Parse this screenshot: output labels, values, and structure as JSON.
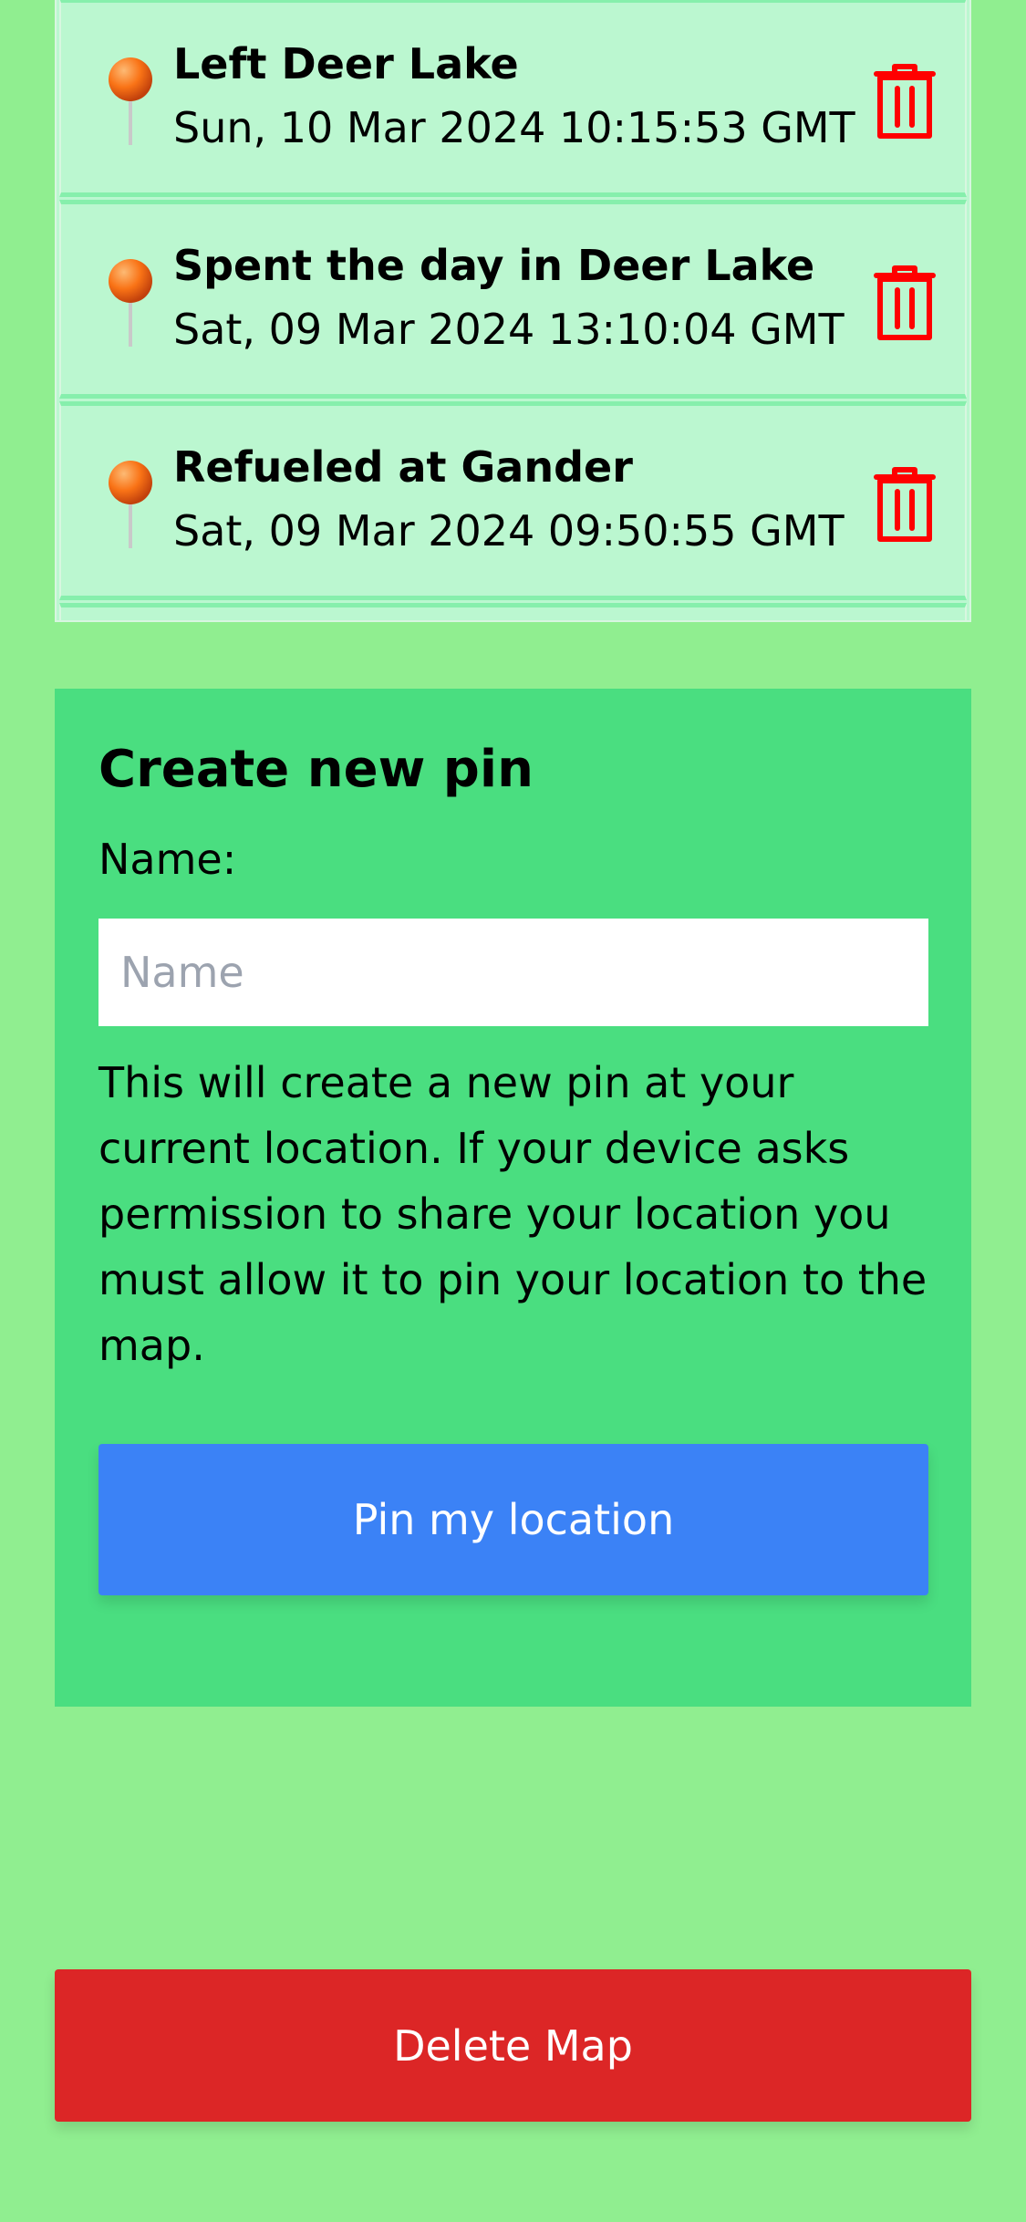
{
  "pins": [
    {
      "name": "Left Deer Lake",
      "date": "Sun, 10 Mar 2024 10:15:53 GMT"
    },
    {
      "name": "Spent the day in Deer Lake",
      "date": "Sat, 09 Mar 2024 13:10:04 GMT"
    },
    {
      "name": "Refueled at Gander",
      "date": "Sat, 09 Mar 2024 09:50:55 GMT"
    }
  ],
  "create": {
    "title": "Create new pin",
    "name_label": "Name:",
    "name_placeholder": "Name",
    "name_value": "",
    "help_text": "This will create a new pin at your current location. If your device asks permission to share your location you must allow it to pin your location to the map.",
    "button_label": "Pin my location"
  },
  "delete_map_label": "Delete Map",
  "icons": {
    "pin": "pushpin-icon",
    "delete": "trash-icon"
  },
  "colors": {
    "background": "#90ee90",
    "list_bg": "#bbf7d0",
    "panel_bg": "#4ade80",
    "primary": "#3b82f6",
    "danger": "#dc2626",
    "trash": "#ff0000"
  }
}
